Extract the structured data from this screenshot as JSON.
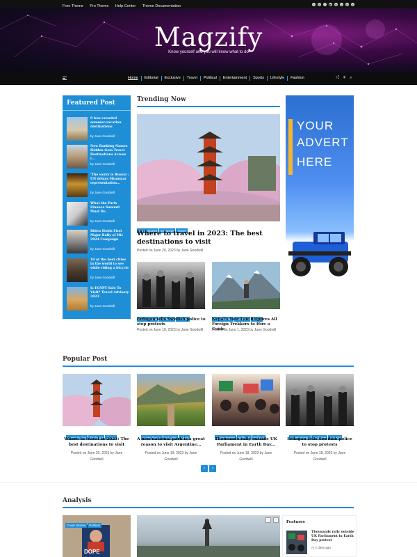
{
  "topbar": {
    "links": [
      "Free Theme",
      "Pro Theme",
      "Help Center",
      "Theme Documentation"
    ],
    "social": [
      "facebook-icon",
      "instagram-icon",
      "twitter-icon",
      "youtube-icon",
      "linkedin-icon",
      "vk-icon",
      "whatsapp-icon",
      "spotify-icon"
    ]
  },
  "header": {
    "brand": "Magzify",
    "tagline": "Know yourself and you will know what to do"
  },
  "nav": {
    "items": [
      "Home",
      "Editorial",
      "Exclusive",
      "Travel",
      "Political",
      "Entertainment",
      "Sports",
      "Lifestyle",
      "Fashion"
    ]
  },
  "featured": {
    "title": "Featured Post",
    "items": [
      {
        "title": "9 less-crowded summer-vacation destinations",
        "author": "by Jane Goodwill"
      },
      {
        "title": "New Banking Names Hidden Gem Travel Destinations Across i...",
        "author": "by Jane Goodwill"
      },
      {
        "title": "‘The worry is Russia’: UN delays Myanmar representation...",
        "author": "by Jane Goodwill"
      },
      {
        "title": "What the Paris Finance Summit Must Do",
        "author": "by Jane Goodwill"
      },
      {
        "title": "Biden Holds First Major Rally of His 2024 Campaign",
        "author": "by Jane Goodwill"
      },
      {
        "title": "10 of the best cities in the world to see while riding a bicycle",
        "author": "by Jane Goodwill"
      },
      {
        "title": "Is EGYPT Safe To Visit? Travel Advisory 2023",
        "author": "by Jane Goodwill"
      }
    ]
  },
  "trending": {
    "title": "Trending Now",
    "main": {
      "tags": [
        "Cover Stories",
        "Exclusive",
        "Travel"
      ],
      "headline": "Where to travel in 2023: The best destinations to visit",
      "meta": "Posted on June 20, 2023 by Jane Goodwill"
    },
    "left": {
      "tags": [
        "Cover Stories",
        "Exclusive",
        "Political"
      ],
      "headline": "Erdogan tells Swedish police to stop protests",
      "meta": "Posted on June 18, 2023 by Jane Goodwill"
    },
    "right": {
      "tags": [
        "Cover Stories",
        "Exclusive",
        "Travel"
      ],
      "headline": "Nepal’s New Law Requires All Foreign Trekkers to Hire a Guide",
      "meta": "Posted on June 1, 2023 by Jane Goodwill"
    }
  },
  "ad": {
    "line1": "YOUR",
    "line2": "ADVERT",
    "line3": "HERE"
  },
  "popular": {
    "title": "Popular Post",
    "items": [
      {
        "tags": [
          "Cover Stories",
          "Exclusive",
          "Travel"
        ],
        "headline": "Where to travel in 2023: The best destinations to visit",
        "meta1": "Posted on June 20, 2023 by Jane",
        "meta2": "Goodwill"
      },
      {
        "tags": [
          "Cover Stories",
          "Editorial",
          "Travel"
        ],
        "headline": "A new national park is a great reason to visit Argentine...",
        "meta1": "Posted on June 19, 2023 by Jane",
        "meta2": "Goodwill"
      },
      {
        "tags": [
          "Cover Stories",
          "Editorial",
          "Political"
        ],
        "headline": "Thousands rally outside UK Parliament in Earth Day...",
        "meta1": "Posted on June 18, 2023 by Jane",
        "meta2": "Goodwill"
      },
      {
        "tags": [
          "Cover Stories",
          "Exclusive",
          "Political"
        ],
        "headline": "Erdogan tells Swedish police to stop protests",
        "meta1": "Posted on June 18, 2023 by Jane",
        "meta2": "Goodwill"
      }
    ],
    "prev": "‹",
    "next": "›"
  },
  "analysis": {
    "title": "Analysis",
    "card_tags": [
      "Cover Stories",
      "Political"
    ],
    "poster_text": "DOPE",
    "prev": "‹",
    "next": "›",
    "features": {
      "title": "Features",
      "headline": "Thousands rally outside UK Parliament in Earth Day protest",
      "date": "2 days ago"
    }
  },
  "colors": {
    "accent": "#1e8ed6",
    "nav_bg": "#0d0d0d",
    "ad_yellow": "#f5b52e"
  }
}
